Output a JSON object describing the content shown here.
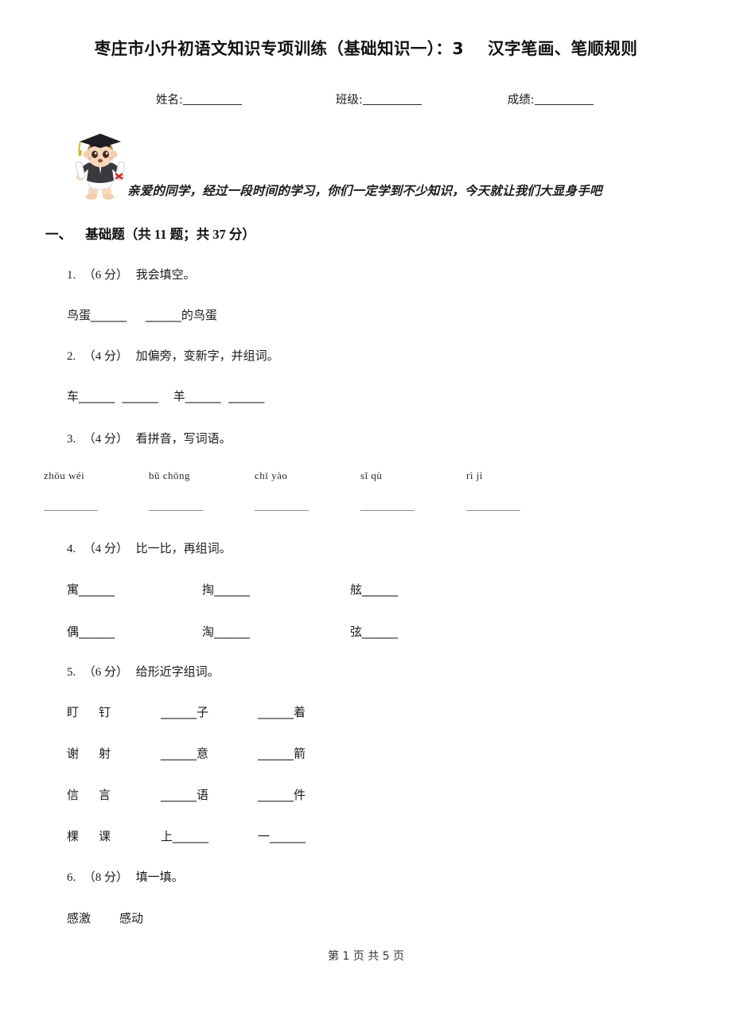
{
  "document": {
    "title": "枣庄市小升初语文知识专项训练（基础知识一）：3    汉字笔画、笔顺规则"
  },
  "id_row": {
    "name_label": "姓名:",
    "class_label": "班级:",
    "score_label": "成绩:"
  },
  "mascot": {
    "icon": "graduate-baby-mascot",
    "cap_color": "#1e1e22",
    "tassel_color": "#d8b43c",
    "skin_color": "#f6d8bd",
    "hair_color": "#b3834c",
    "gown_color": "#3a3a3e"
  },
  "greeting": {
    "text": "亲爱的同学，经过一段时间的学习，你们一定学到不少知识，今天就让我们大显身手吧"
  },
  "section": {
    "index": "一、",
    "title": "基础题",
    "meta": "（共 11 题；共 37 分）"
  },
  "questions": [
    {
      "num": "1.",
      "score": "（6 分）",
      "prompt": "我会填空。",
      "rows": [
        {
          "cells": [
            "鸟蛋______",
            "",
            "______的鸟蛋"
          ]
        }
      ]
    },
    {
      "num": "2.",
      "score": "（4 分）",
      "prompt": "加偏旁，变新字，并组词。",
      "rows": [
        {
          "cells": [
            "车______",
            "______",
            "羊______",
            "______"
          ]
        }
      ]
    },
    {
      "num": "3.",
      "score": "（4 分）",
      "prompt": "看拼音，写词语。",
      "pinyin": [
        "zhōu  wéi",
        "bǔ  chōng",
        "chī  yào",
        "sǐ  qù",
        "rì  jì"
      ],
      "blank_count": 5
    },
    {
      "num": "4.",
      "score": "（4 分）",
      "prompt": "比一比，再组词。",
      "rows": [
        {
          "cells": [
            "寓______",
            "掏______",
            "舷______"
          ]
        },
        {
          "cells": [
            "偶______",
            "淘______",
            "弦______"
          ]
        }
      ]
    },
    {
      "num": "5.",
      "score": "（6 分）",
      "prompt": "给形近字组词。",
      "rows": [
        {
          "cells": [
            "盯",
            "钉",
            "______子",
            "______着"
          ]
        },
        {
          "cells": [
            "谢",
            "射",
            "______意",
            "______箭"
          ]
        },
        {
          "cells": [
            "信",
            "言",
            "______语",
            "______件"
          ]
        },
        {
          "cells": [
            "棵",
            "课",
            "上______",
            "一______"
          ]
        }
      ]
    },
    {
      "num": "6.",
      "score": "（8 分）",
      "prompt": "填一填。",
      "rows": [
        {
          "cells": [
            "感激",
            "感动"
          ]
        }
      ]
    }
  ],
  "footer": {
    "text": "第 1 页 共 5 页"
  }
}
